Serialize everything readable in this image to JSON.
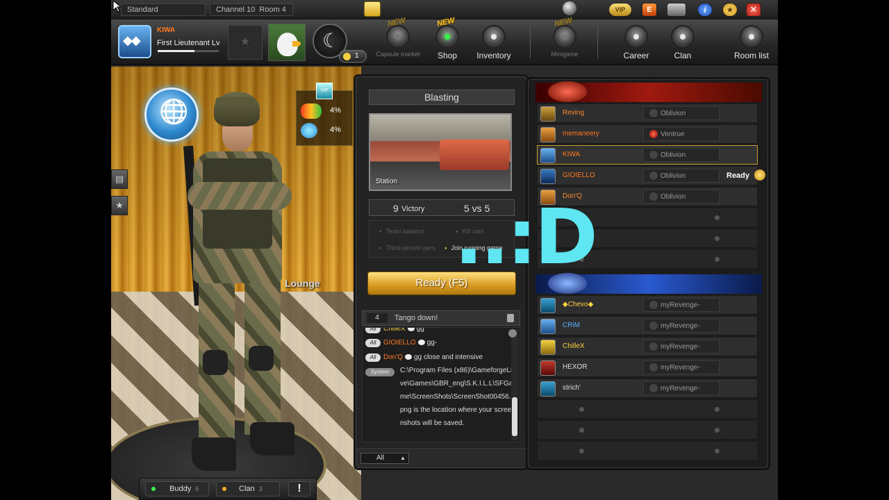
{
  "top": {
    "mode": "Standard",
    "channel": "Channel 10",
    "room": "Room 4",
    "vip_label": "VIP",
    "e_label": "E"
  },
  "player": {
    "name": "KIWA",
    "rank": "First Lieutenant Lv.",
    "coins": "1",
    "xp_fraction": 0.6
  },
  "menu": {
    "items": [
      {
        "label": "Capsule market",
        "badge": "NEW",
        "state": "dim"
      },
      {
        "label": "Shop",
        "badge": "NEW",
        "state": "active"
      },
      {
        "label": "Inventory",
        "badge": "",
        "state": "normal"
      },
      {
        "label": "Minigame",
        "badge": "NEW",
        "state": "dim"
      },
      {
        "label": "Career",
        "badge": "",
        "state": "normal"
      },
      {
        "label": "Clan",
        "badge": "",
        "state": "normal"
      },
      {
        "label": "Room list",
        "badge": "",
        "state": "normal"
      }
    ]
  },
  "lobby": {
    "lounge_sign": "Lounge",
    "boosts": [
      {
        "icon": "pills-icon",
        "value": "4%"
      },
      {
        "icon": "globe-icon",
        "value": "4%"
      }
    ]
  },
  "room": {
    "mode_title": "Blasting",
    "map_name": "Station",
    "victory_count": "9",
    "victory_label": "Victory",
    "teams": "5 vs 5",
    "rules": [
      {
        "label": "Team balance",
        "on": false
      },
      {
        "label": "Kill cam",
        "on": false
      },
      {
        "label": "Third-person pers",
        "on": false
      },
      {
        "label": "Join running game",
        "on": true
      }
    ],
    "ready_button": "Ready (F5)"
  },
  "chat": {
    "room_number": "4",
    "room_title": "Tango down!",
    "lines": [
      {
        "channel": "All",
        "nick": "ChilleX",
        "text": "gg",
        "nick_color": "y"
      },
      {
        "channel": "All",
        "nick": "GIOIELLO",
        "text": "gg-",
        "nick_color": "o"
      },
      {
        "channel": "All",
        "nick": "Don'Q",
        "text": "gg close and intensive",
        "nick_color": "o"
      }
    ],
    "system_tag": "System",
    "system_text": "C:\\Program Files (x86)\\GameforgeLive\\Games\\GBR_eng\\S.K.I.L.L\\SFGame\\ScreenShots\\ScreenShot00456.png is the location where your screenshots will be saved.",
    "filter": "All"
  },
  "red_team": [
    {
      "name": "Reving",
      "name_color": "#ff8a30",
      "clan": "Oblivion",
      "clan_mark": "grey",
      "me": false,
      "ready": false
    },
    {
      "name": "memaneery",
      "name_color": "#ff7a20",
      "clan": "Ventrue",
      "clan_mark": "red",
      "me": false,
      "ready": false
    },
    {
      "name": "KIWA",
      "name_color": "#ff7a20",
      "clan": "Oblivion",
      "clan_mark": "grey",
      "me": true,
      "ready": false
    },
    {
      "name": "GIOIELLO",
      "name_color": "#ff7a20",
      "clan": "Oblivion",
      "clan_mark": "grey",
      "me": false,
      "ready": true,
      "ready_label": "Ready"
    },
    {
      "name": "Don'Q",
      "name_color": "#ff8a30",
      "clan": "Oblivion",
      "clan_mark": "grey",
      "me": false,
      "ready": false
    }
  ],
  "blue_team": [
    {
      "name": "◆Chevo◆",
      "name_color": "#ffd040",
      "clan": "myRevenge-",
      "clan_mark": "grey"
    },
    {
      "name": "CRiM",
      "name_color": "#5ab0ff",
      "clan": "myRevenge-",
      "clan_mark": "grey"
    },
    {
      "name": "ChilleX",
      "name_color": "#ffd040",
      "clan": "myRevenge-",
      "clan_mark": "grey"
    },
    {
      "name": "HEXOR",
      "name_color": "#dddddd",
      "clan": "myRevenge-",
      "clan_mark": "grey"
    },
    {
      "name": "strich'",
      "name_color": "#dddddd",
      "clan": "myRevenge-",
      "clan_mark": "grey"
    }
  ],
  "bottom": {
    "buddy_label": "Buddy",
    "buddy_count": "6",
    "clan_label": "Clan",
    "clan_count": "3",
    "alert_label": "!"
  },
  "overlay": "..:D"
}
